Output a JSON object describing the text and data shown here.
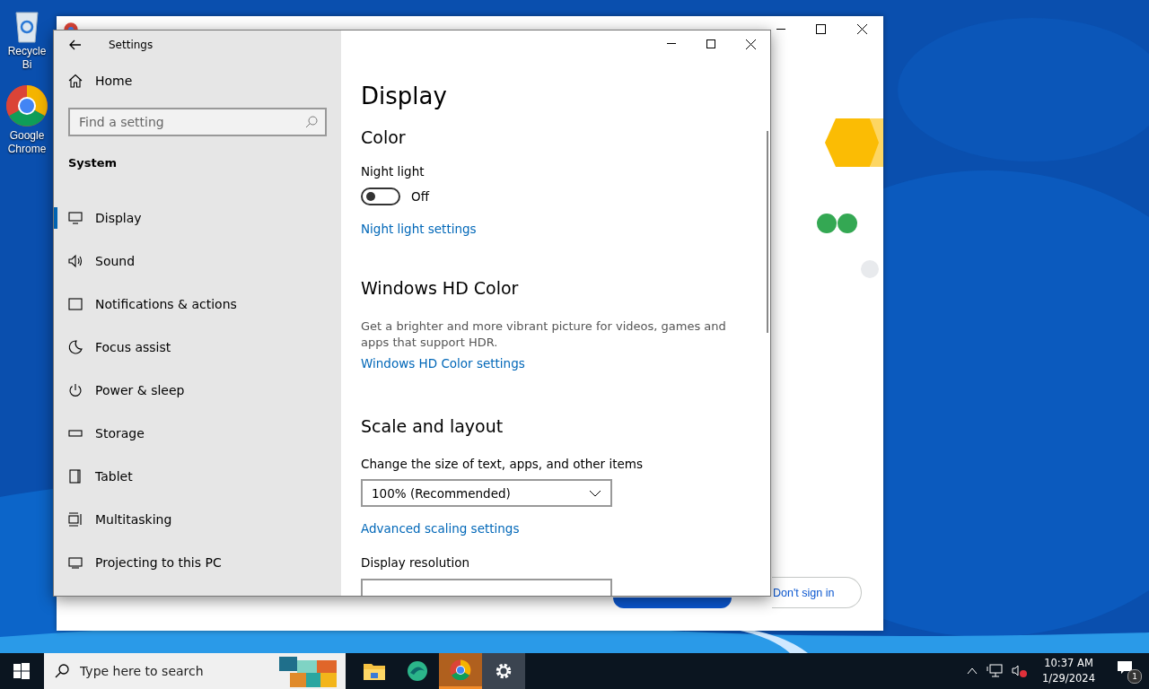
{
  "desktop_icons": [
    {
      "kind": "recycle",
      "label": "Recycle Bi"
    },
    {
      "kind": "chrome",
      "label": "Google Chrome"
    }
  ],
  "chrome_window": {
    "secondary_button": "Don't sign in"
  },
  "settings": {
    "title": "Settings",
    "home": "Home",
    "search": {
      "placeholder": "Find a setting"
    },
    "section": "System",
    "nav": [
      {
        "kind": "display",
        "label": "Display",
        "selected": true
      },
      {
        "kind": "sound",
        "label": "Sound",
        "selected": false
      },
      {
        "kind": "notifications",
        "label": "Notifications & actions",
        "selected": false
      },
      {
        "kind": "focus",
        "label": "Focus assist",
        "selected": false
      },
      {
        "kind": "power",
        "label": "Power & sleep",
        "selected": false
      },
      {
        "kind": "storage",
        "label": "Storage",
        "selected": false
      },
      {
        "kind": "tablet",
        "label": "Tablet",
        "selected": false
      },
      {
        "kind": "multitasking",
        "label": "Multitasking",
        "selected": false
      },
      {
        "kind": "projecting",
        "label": "Projecting to this PC",
        "selected": false
      }
    ],
    "page_title": "Display",
    "color": {
      "heading": "Color",
      "night_light_label": "Night light",
      "night_light": {
        "on": false,
        "state": "Off"
      },
      "link": "Night light settings"
    },
    "hd_color": {
      "heading": "Windows HD Color",
      "description": "Get a brighter and more vibrant picture for videos, games and apps that support HDR.",
      "link": "Windows HD Color settings"
    },
    "scale": {
      "heading": "Scale and layout",
      "size_label": "Change the size of text, apps, and other items",
      "size_value": "100% (Recommended)",
      "link": "Advanced scaling settings",
      "resolution_label": "Display resolution"
    }
  },
  "taskbar": {
    "search_placeholder": "Type here to search",
    "apps": [
      {
        "kind": "folder",
        "selected": false,
        "flashing": false
      },
      {
        "kind": "browser",
        "selected": false,
        "flashing": false
      },
      {
        "kind": "chrome",
        "selected": false,
        "flashing": true
      },
      {
        "kind": "settings",
        "selected": true,
        "flashing": false
      }
    ],
    "time": "10:37 AM",
    "date": "1/29/2024",
    "notifications": "1"
  }
}
